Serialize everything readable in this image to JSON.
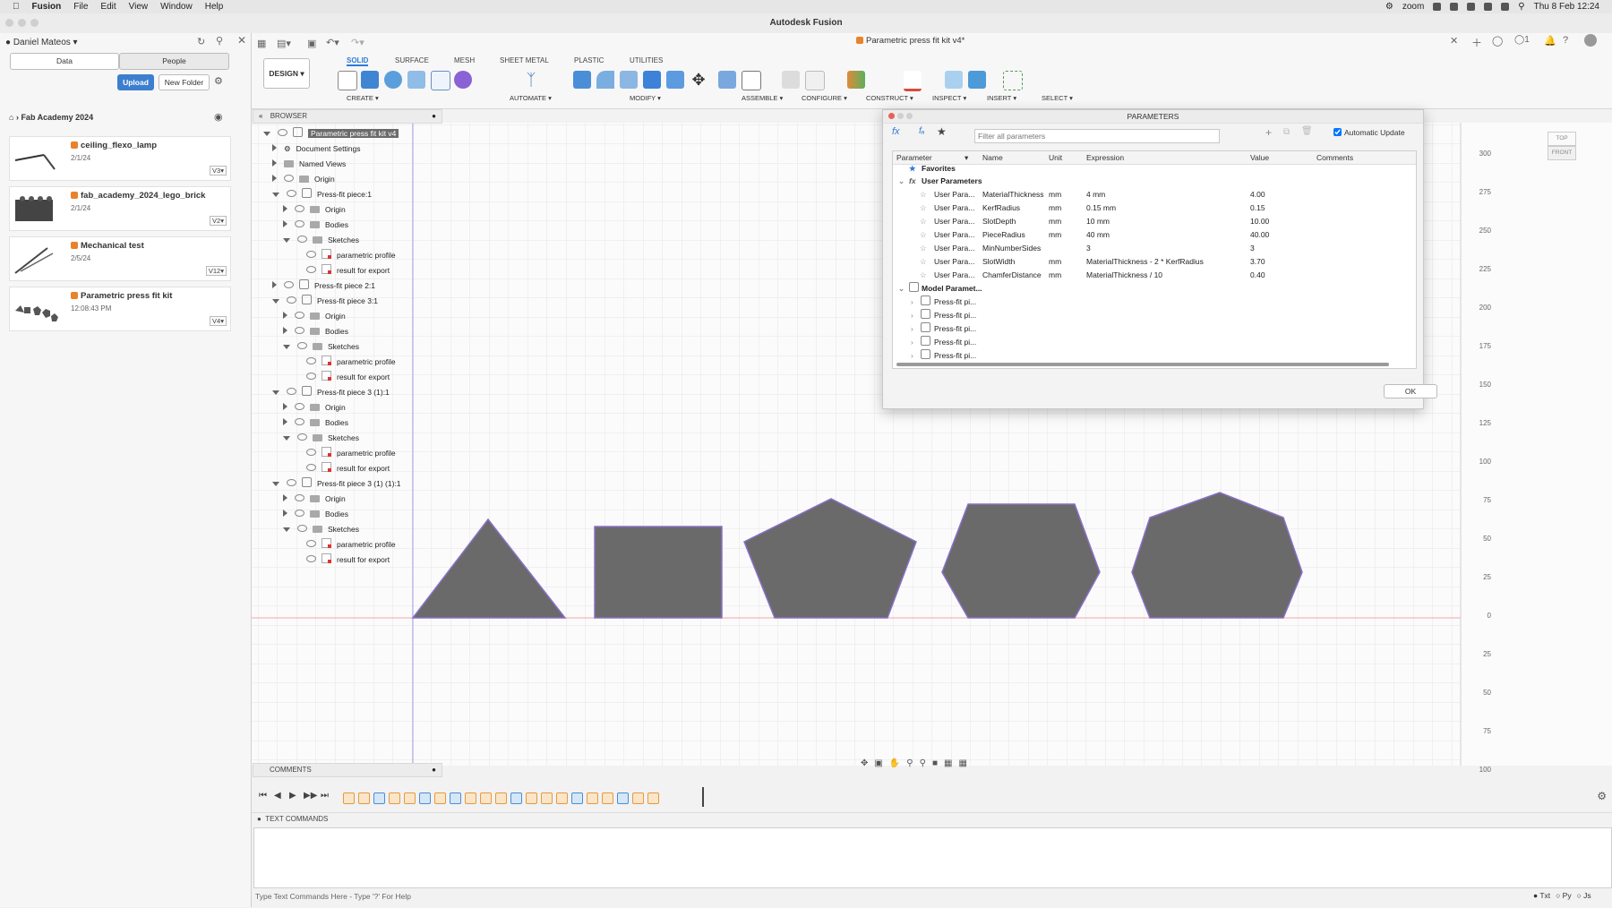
{
  "menubar": {
    "apple": "",
    "app": "Fusion",
    "items": [
      "File",
      "Edit",
      "View",
      "Window",
      "Help"
    ],
    "zoom": "zoom",
    "datetime": "Thu 8 Feb 12:24"
  },
  "window_title": "Autodesk Fusion",
  "data_panel": {
    "user": "Daniel Mateos",
    "tabs": [
      "Data",
      "People"
    ],
    "upload": "Upload",
    "new_folder": "New Folder",
    "breadcrumb": "Fab Academy 2024",
    "files": [
      {
        "name": "ceiling_flexo_lamp",
        "date": "2/1/24",
        "version": "V3"
      },
      {
        "name": "fab_academy_2024_lego_brick",
        "date": "2/1/24",
        "version": "V2"
      },
      {
        "name": "Mechanical test",
        "date": "2/5/24",
        "version": "V12"
      },
      {
        "name": "Parametric press fit kit",
        "date": "12:08:43 PM",
        "version": "V4"
      }
    ]
  },
  "document_tab": "Parametric press fit kit v4*",
  "toolbar": {
    "workspace": "DESIGN",
    "tabs": [
      "SOLID",
      "SURFACE",
      "MESH",
      "SHEET METAL",
      "PLASTIC",
      "UTILITIES"
    ],
    "groups": [
      "CREATE",
      "AUTOMATE",
      "MODIFY",
      "ASSEMBLE",
      "CONFIGURE",
      "CONSTRUCT",
      "INSPECT",
      "INSERT",
      "SELECT"
    ]
  },
  "browser": {
    "title": "BROWSER",
    "root": "Parametric press fit kit v4",
    "rows": [
      "Document Settings",
      "Named Views",
      "Origin",
      "Press-fit piece:1",
      "Origin",
      "Bodies",
      "Sketches",
      "parametric profile",
      "result for export",
      "Press-fit piece 2:1",
      "Press-fit piece 3:1",
      "Origin",
      "Bodies",
      "Sketches",
      "parametric profile",
      "result for export",
      "Press-fit piece 3 (1):1",
      "Origin",
      "Bodies",
      "Sketches",
      "parametric profile",
      "result for export",
      "Press-fit piece 3 (1) (1):1",
      "Origin",
      "Bodies",
      "Sketches",
      "parametric profile",
      "result for export"
    ]
  },
  "parameters": {
    "title": "PARAMETERS",
    "filter_placeholder": "Filter all parameters",
    "auto_update": "Automatic Update",
    "columns": [
      "Parameter",
      "Name",
      "Unit",
      "Expression",
      "Value",
      "Comments"
    ],
    "favorites": "Favorites",
    "user_params_label": "User Parameters",
    "user_params": [
      {
        "type": "User Para...",
        "name": "MaterialThickness",
        "unit": "mm",
        "expression": "4 mm",
        "value": "4.00"
      },
      {
        "type": "User Para...",
        "name": "KerfRadius",
        "unit": "mm",
        "expression": "0.15 mm",
        "value": "0.15"
      },
      {
        "type": "User Para...",
        "name": "SlotDepth",
        "unit": "mm",
        "expression": "10 mm",
        "value": "10.00"
      },
      {
        "type": "User Para...",
        "name": "PieceRadius",
        "unit": "mm",
        "expression": "40 mm",
        "value": "40.00"
      },
      {
        "type": "User Para...",
        "name": "MinNumberSides",
        "unit": "",
        "expression": "3",
        "value": "3"
      },
      {
        "type": "User Para...",
        "name": "SlotWidth",
        "unit": "mm",
        "expression": "MaterialThickness - 2 * KerfRadius",
        "value": "3.70"
      },
      {
        "type": "User Para...",
        "name": "ChamferDistance",
        "unit": "mm",
        "expression": "MaterialThickness / 10",
        "value": "0.40"
      }
    ],
    "model_params_label": "Model Paramet...",
    "model_params": [
      "Press-fit pi...",
      "Press-fit pi...",
      "Press-fit pi...",
      "Press-fit pi...",
      "Press-fit pi..."
    ],
    "ok": "OK"
  },
  "viewcube": {
    "top": "TOP",
    "front": "FRONT"
  },
  "ruler": [
    "300",
    "275",
    "250",
    "225",
    "200",
    "175",
    "150",
    "125",
    "100",
    "75",
    "50",
    "25",
    "0",
    "25",
    "50",
    "75",
    "100"
  ],
  "comments": "COMMENTS",
  "text_commands": {
    "title": "TEXT COMMANDS",
    "placeholder": "Type Text Commands Here - Type '?' For Help",
    "modes": [
      "Txt",
      "Py",
      "Js"
    ]
  }
}
